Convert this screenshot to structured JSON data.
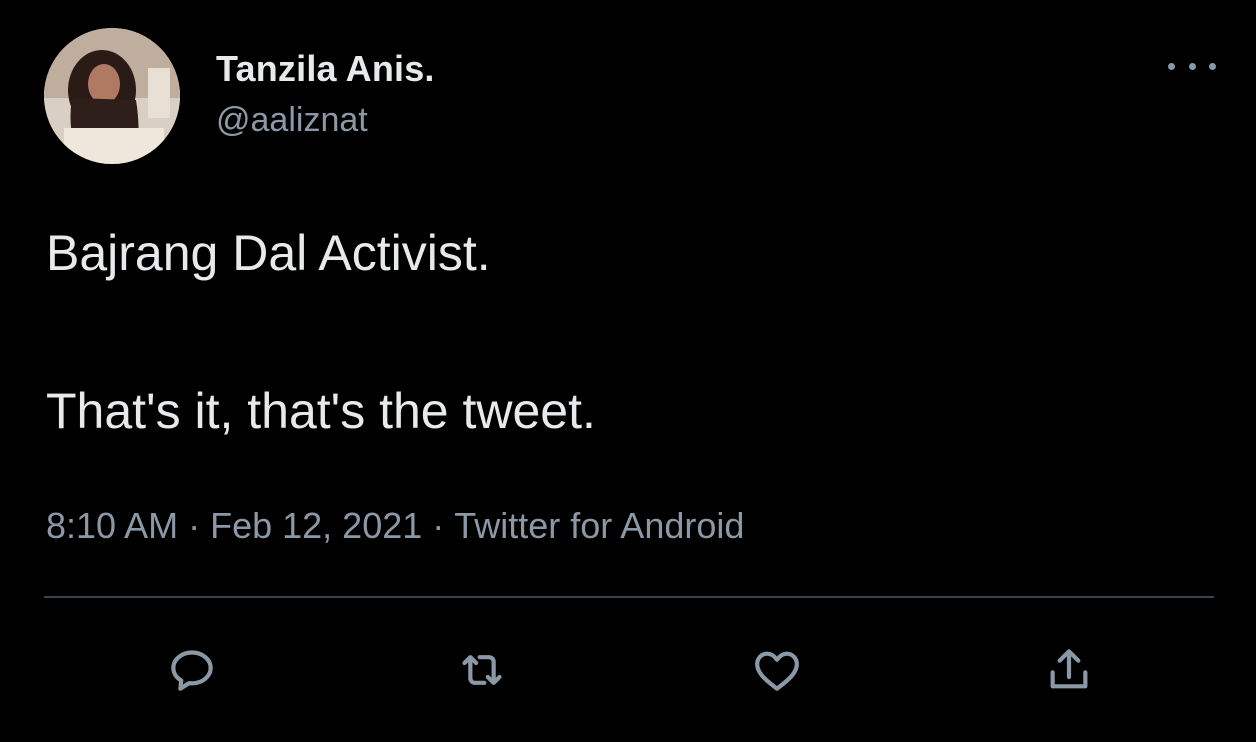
{
  "tweet": {
    "author_name": "Tanzila Anis.",
    "author_handle": "@aaliznat",
    "text_line1": "Bajrang Dal Activist.",
    "text_line2": "That's it, that's the tweet.",
    "time": "8:10 AM",
    "date": "Feb 12, 2021",
    "separator": "·",
    "source": "Twitter for Android"
  },
  "icons": {
    "more": "more-options-icon",
    "reply": "reply-icon",
    "retweet": "retweet-icon",
    "like": "heart-icon",
    "share": "share-icon"
  },
  "colors": {
    "background": "#000000",
    "primary_text": "#e7e9ea",
    "secondary_text": "#8b98a5",
    "divider": "#38444d"
  }
}
